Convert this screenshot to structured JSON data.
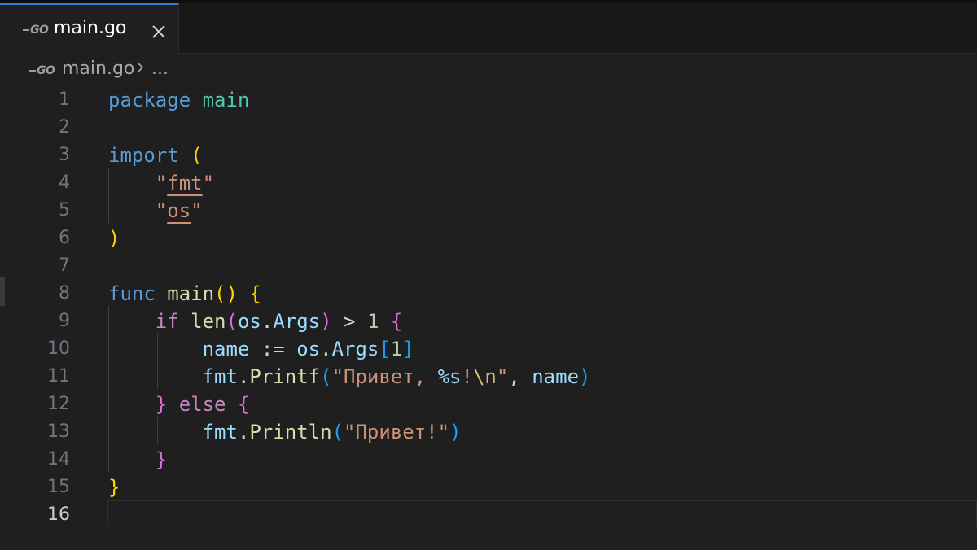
{
  "tab": {
    "label": "main.go",
    "icon": "go-file-icon"
  },
  "breadcrumb": {
    "file": "main.go",
    "rest": "..."
  },
  "lines": [
    {
      "n": "1",
      "tokens": [
        [
          "kw",
          "package"
        ],
        [
          "txt",
          " "
        ],
        [
          "pkg",
          "main"
        ]
      ]
    },
    {
      "n": "2",
      "tokens": []
    },
    {
      "n": "3",
      "tokens": [
        [
          "kw",
          "import"
        ],
        [
          "txt",
          " "
        ],
        [
          "b1",
          "("
        ]
      ]
    },
    {
      "n": "4",
      "tokens": [
        [
          "txt",
          "    "
        ],
        [
          "str",
          "\""
        ],
        [
          "str ul",
          "fmt"
        ],
        [
          "str",
          "\""
        ]
      ]
    },
    {
      "n": "5",
      "tokens": [
        [
          "txt",
          "    "
        ],
        [
          "str",
          "\""
        ],
        [
          "str ul",
          "os"
        ],
        [
          "str",
          "\""
        ]
      ]
    },
    {
      "n": "6",
      "tokens": [
        [
          "b1",
          ")"
        ]
      ]
    },
    {
      "n": "7",
      "tokens": []
    },
    {
      "n": "8",
      "tokens": [
        [
          "kw",
          "func"
        ],
        [
          "txt",
          " "
        ],
        [
          "fn",
          "main"
        ],
        [
          "b1",
          "()"
        ],
        [
          "txt",
          " "
        ],
        [
          "b1",
          "{"
        ]
      ]
    },
    {
      "n": "9",
      "tokens": [
        [
          "txt",
          "    "
        ],
        [
          "kw2",
          "if"
        ],
        [
          "txt",
          " "
        ],
        [
          "fn",
          "len"
        ],
        [
          "b2",
          "("
        ],
        [
          "var",
          "os"
        ],
        [
          "txt",
          "."
        ],
        [
          "var",
          "Args"
        ],
        [
          "b2",
          ")"
        ],
        [
          "txt",
          " > "
        ],
        [
          "num",
          "1"
        ],
        [
          "txt",
          " "
        ],
        [
          "b2",
          "{"
        ]
      ]
    },
    {
      "n": "10",
      "tokens": [
        [
          "txt",
          "        "
        ],
        [
          "var",
          "name"
        ],
        [
          "txt",
          " := "
        ],
        [
          "var",
          "os"
        ],
        [
          "txt",
          "."
        ],
        [
          "var",
          "Args"
        ],
        [
          "b3",
          "["
        ],
        [
          "num",
          "1"
        ],
        [
          "b3",
          "]"
        ]
      ]
    },
    {
      "n": "11",
      "tokens": [
        [
          "txt",
          "        "
        ],
        [
          "var",
          "fmt"
        ],
        [
          "txt",
          "."
        ],
        [
          "fn",
          "Printf"
        ],
        [
          "b3",
          "("
        ],
        [
          "str",
          "\"Привет, "
        ],
        [
          "var",
          "%s"
        ],
        [
          "str",
          "!"
        ],
        [
          "esc",
          "\\n"
        ],
        [
          "str",
          "\""
        ],
        [
          "txt",
          ", "
        ],
        [
          "var",
          "name"
        ],
        [
          "b3",
          ")"
        ]
      ]
    },
    {
      "n": "12",
      "tokens": [
        [
          "txt",
          "    "
        ],
        [
          "b2",
          "}"
        ],
        [
          "txt",
          " "
        ],
        [
          "kw2",
          "else"
        ],
        [
          "txt",
          " "
        ],
        [
          "b2",
          "{"
        ]
      ]
    },
    {
      "n": "13",
      "tokens": [
        [
          "txt",
          "        "
        ],
        [
          "var",
          "fmt"
        ],
        [
          "txt",
          "."
        ],
        [
          "fn",
          "Println"
        ],
        [
          "b3",
          "("
        ],
        [
          "str",
          "\"Привет!\""
        ],
        [
          "b3",
          ")"
        ]
      ]
    },
    {
      "n": "14",
      "tokens": [
        [
          "txt",
          "    "
        ],
        [
          "b2",
          "}"
        ]
      ]
    },
    {
      "n": "15",
      "tokens": [
        [
          "b1",
          "}"
        ]
      ]
    },
    {
      "n": "16",
      "tokens": []
    }
  ],
  "active_line": "16",
  "colors": {
    "background": "#1f1f1f",
    "tab_accent": "#2a7fd4",
    "keyword": "#569cd6",
    "control": "#c586c0",
    "function": "#dcdcaa",
    "variable": "#9cdcfe",
    "string": "#ce9178",
    "number": "#b5cea8"
  }
}
